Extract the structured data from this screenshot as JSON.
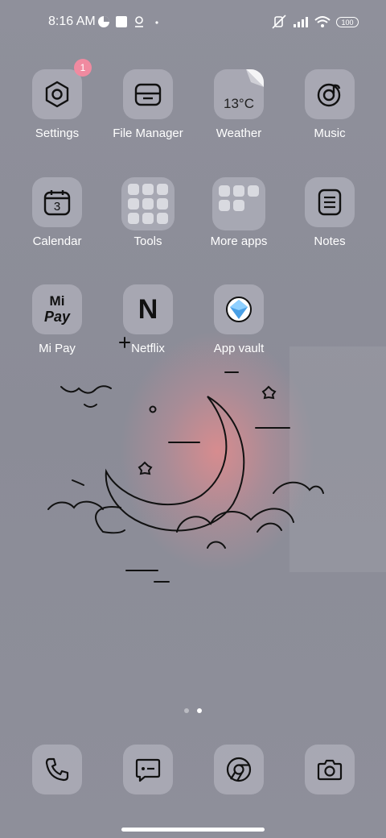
{
  "status_bar": {
    "time": "8:16 AM",
    "battery_level": "100",
    "icons": [
      "data-saver-icon",
      "square-notification-icon",
      "location-icon",
      "dot-icon",
      "mute-icon",
      "signal-icon",
      "wifi-icon",
      "battery-icon"
    ]
  },
  "apps": [
    {
      "label": "Settings",
      "icon": "gear-hex-icon",
      "badge": "1"
    },
    {
      "label": "File Manager",
      "icon": "folder-icon"
    },
    {
      "label": "Weather",
      "icon": "weather-icon",
      "value": "13°C"
    },
    {
      "label": "Music",
      "icon": "music-disc-icon"
    },
    {
      "label": "Calendar",
      "icon": "calendar-icon",
      "value": "3"
    },
    {
      "label": "Tools",
      "icon": "folder-tools-icon"
    },
    {
      "label": "More apps",
      "icon": "folder-more-apps-icon"
    },
    {
      "label": "Notes",
      "icon": "notes-icon"
    },
    {
      "label": "Mi Pay",
      "icon": "mi-pay-icon",
      "value_top": "Mi",
      "value_bottom": "Pay"
    },
    {
      "label": "Netflix",
      "icon": "netflix-icon",
      "value": "N"
    },
    {
      "label": "App vault",
      "icon": "app-vault-icon"
    }
  ],
  "dock": [
    {
      "icon": "phone-icon"
    },
    {
      "icon": "messages-icon"
    },
    {
      "icon": "chrome-icon"
    },
    {
      "icon": "camera-icon"
    }
  ],
  "pages": {
    "total": 2,
    "current": 2
  },
  "colors": {
    "badge": "#f08aa0",
    "wallpaper": "#8e8f9a",
    "glow": "#f08c8c"
  }
}
